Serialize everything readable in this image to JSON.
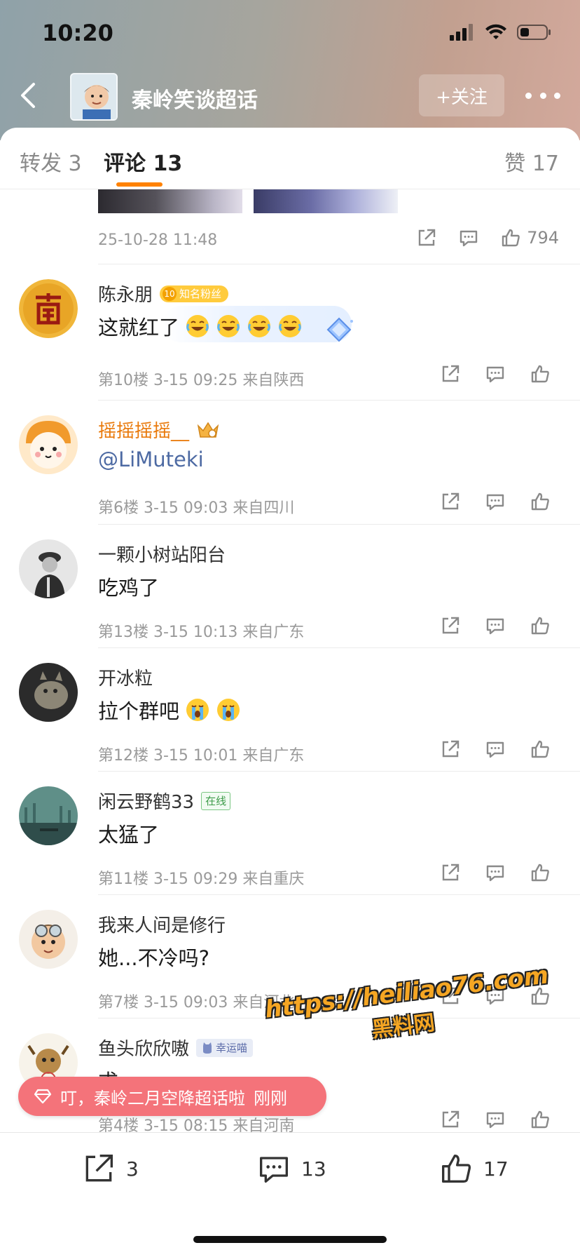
{
  "status_bar": {
    "time": "10:20"
  },
  "header": {
    "title": "秦岭笑谈超话",
    "follow_label": "+关注"
  },
  "tabs": [
    {
      "label": "转发",
      "count": "3"
    },
    {
      "label": "评论",
      "count": "13"
    },
    {
      "label": "赞",
      "count": "17"
    }
  ],
  "post": {
    "timestamp": "25-10-28 11:48",
    "like_count": "794"
  },
  "comments": [
    {
      "name": "陈永朋",
      "badge": "知名粉丝",
      "badge_level": "10",
      "text": "这就红了",
      "emojis": [
        "laugh-cry",
        "laugh-cry",
        "laugh-cry",
        "laugh-cry"
      ],
      "floor": "第10楼",
      "time": "3-15 09:25",
      "location": "来自陕西"
    },
    {
      "name": "摇摇摇摇__",
      "text": "@LiMuteki",
      "floor": "第6楼",
      "time": "3-15 09:03",
      "location": "来自四川"
    },
    {
      "name": "一颗小树站阳台",
      "text": "吃鸡了",
      "floor": "第13楼",
      "time": "3-15 10:13",
      "location": "来自广东"
    },
    {
      "name": "开冰粒",
      "text": "拉个群吧",
      "emojis": [
        "crying",
        "crying"
      ],
      "floor": "第12楼",
      "time": "3-15 10:01",
      "location": "来自广东"
    },
    {
      "name": "闲云野鹤33",
      "badge": "在线",
      "text": "太猛了",
      "floor": "第11楼",
      "time": "3-15 09:29",
      "location": "来自重庆"
    },
    {
      "name": "我来人间是修行",
      "text": "她...不冷吗?",
      "floor": "第7楼",
      "time": "3-15 09:03",
      "location": "来自河北"
    },
    {
      "name": "鱼头欣欣嗷",
      "badge": "幸运喵",
      "text": "求",
      "floor": "第4楼",
      "time": "3-15 08:15",
      "location": "来自河南"
    }
  ],
  "toast": {
    "text": "叮，秦岭二月空降超话啦",
    "time": "刚刚"
  },
  "watermark": {
    "url": "https://heiliao76.com",
    "text": "黑料网"
  },
  "bottom_bar": {
    "repost_count": "3",
    "comment_count": "13",
    "like_count": "17"
  },
  "colors": {
    "accent": "#ff8200",
    "toast": "#f4737a",
    "link": "#4d6aa3"
  }
}
